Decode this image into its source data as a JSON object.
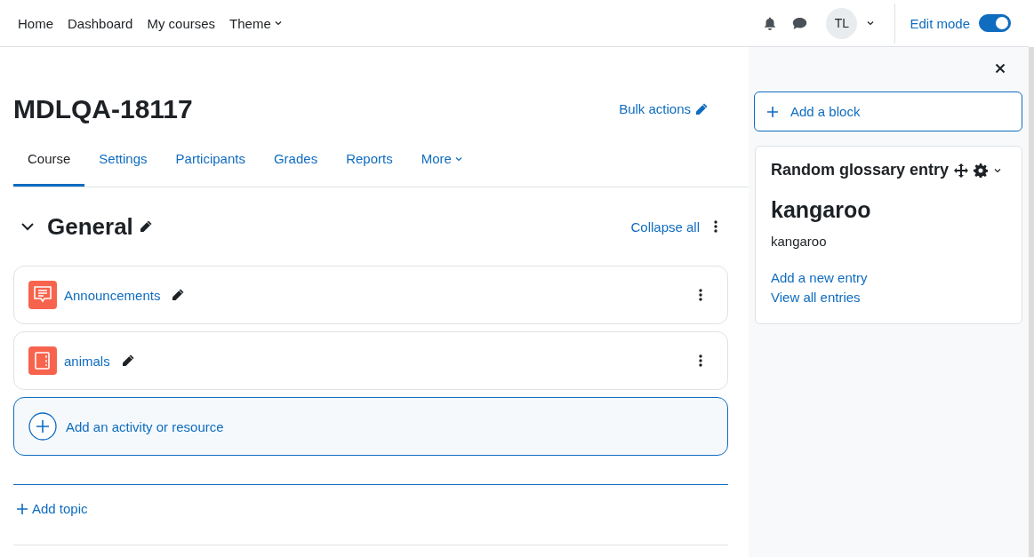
{
  "navbar": {
    "links": [
      {
        "label": "Home",
        "dropdown": false
      },
      {
        "label": "Dashboard",
        "dropdown": false
      },
      {
        "label": "My courses",
        "dropdown": false
      },
      {
        "label": "Theme",
        "dropdown": true
      }
    ],
    "avatar": "TL",
    "edit_mode": {
      "label": "Edit mode",
      "on": true
    }
  },
  "course": {
    "title": "MDLQA-18117",
    "bulk_actions": "Bulk actions",
    "tabs": [
      {
        "label": "Course",
        "selected": true,
        "dropdown": false
      },
      {
        "label": "Settings",
        "selected": false,
        "dropdown": false
      },
      {
        "label": "Participants",
        "selected": false,
        "dropdown": false
      },
      {
        "label": "Grades",
        "selected": false,
        "dropdown": false
      },
      {
        "label": "Reports",
        "selected": false,
        "dropdown": false
      },
      {
        "label": "More",
        "selected": false,
        "dropdown": true
      }
    ]
  },
  "section": {
    "title": "General",
    "expanded": true,
    "collapse_all": "Collapse all",
    "activities": [
      {
        "kind": "forum",
        "name": "Announcements"
      },
      {
        "kind": "book",
        "name": "animals"
      }
    ],
    "add_activity": "Add an activity or resource"
  },
  "add_topic": "Add topic",
  "drawer": {
    "add_block": "Add a block",
    "block": {
      "title": "Random glossary entry",
      "concept": "kangaroo",
      "definition": "kangaroo",
      "links": [
        "Add a new entry",
        "View all entries"
      ]
    }
  }
}
